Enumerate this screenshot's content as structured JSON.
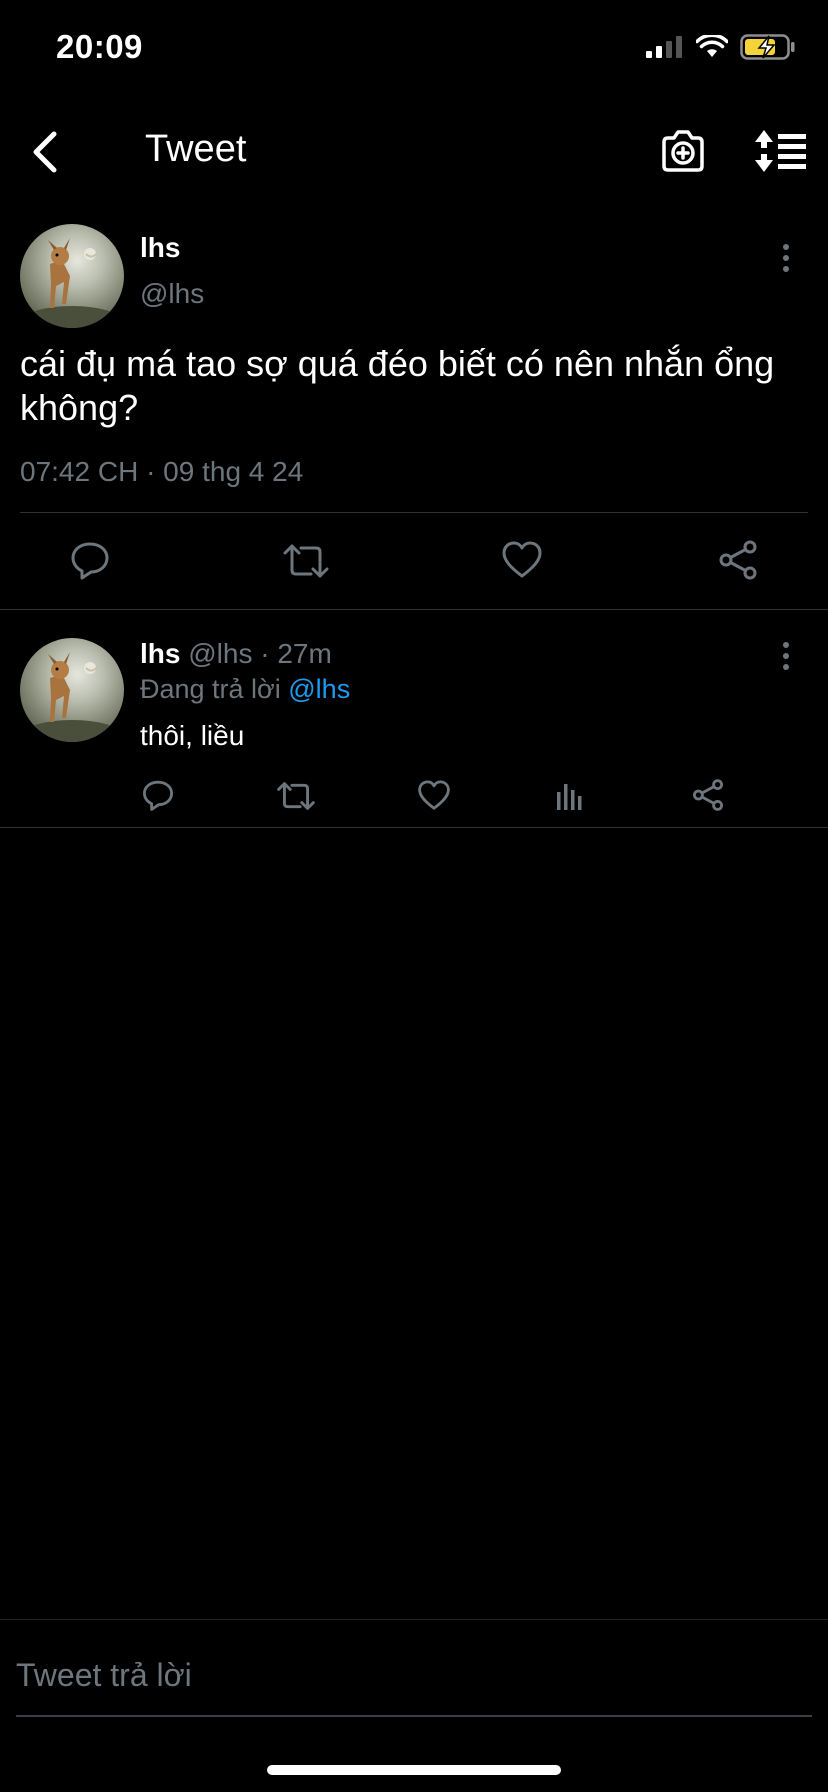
{
  "status_bar": {
    "time": "20:09",
    "icons": [
      "signal-icon",
      "wifi-icon",
      "battery-charging-icon"
    ],
    "battery_color": "#f5d33a"
  },
  "nav": {
    "title": "Tweet",
    "icons": [
      "back-chevron-icon",
      "camera-plus-icon",
      "sort-icon"
    ]
  },
  "main_tweet": {
    "name": "lhs",
    "handle": "@lhs",
    "text": "cái đụ má tao sợ quá đéo biết có nên nhắn ổng không?",
    "meta": "07:42 CH · 09 thg 4 24",
    "actions": [
      "reply-icon",
      "retweet-icon",
      "like-icon",
      "share-icon"
    ]
  },
  "reply": {
    "name": "lhs",
    "handle": "@lhs",
    "separator": " · ",
    "time": "27m",
    "replying_prefix": "Đang trả lời ",
    "replying_to": "@lhs",
    "text": "thôi, liều",
    "actions": [
      "reply-icon",
      "retweet-icon",
      "like-icon",
      "analytics-icon",
      "share-icon"
    ]
  },
  "composer": {
    "placeholder": "Tweet trả lời"
  },
  "colors": {
    "background": "#000000",
    "muted_text": "#6e767d",
    "accent": "#1d9bf0",
    "divider": "#2f3336"
  }
}
